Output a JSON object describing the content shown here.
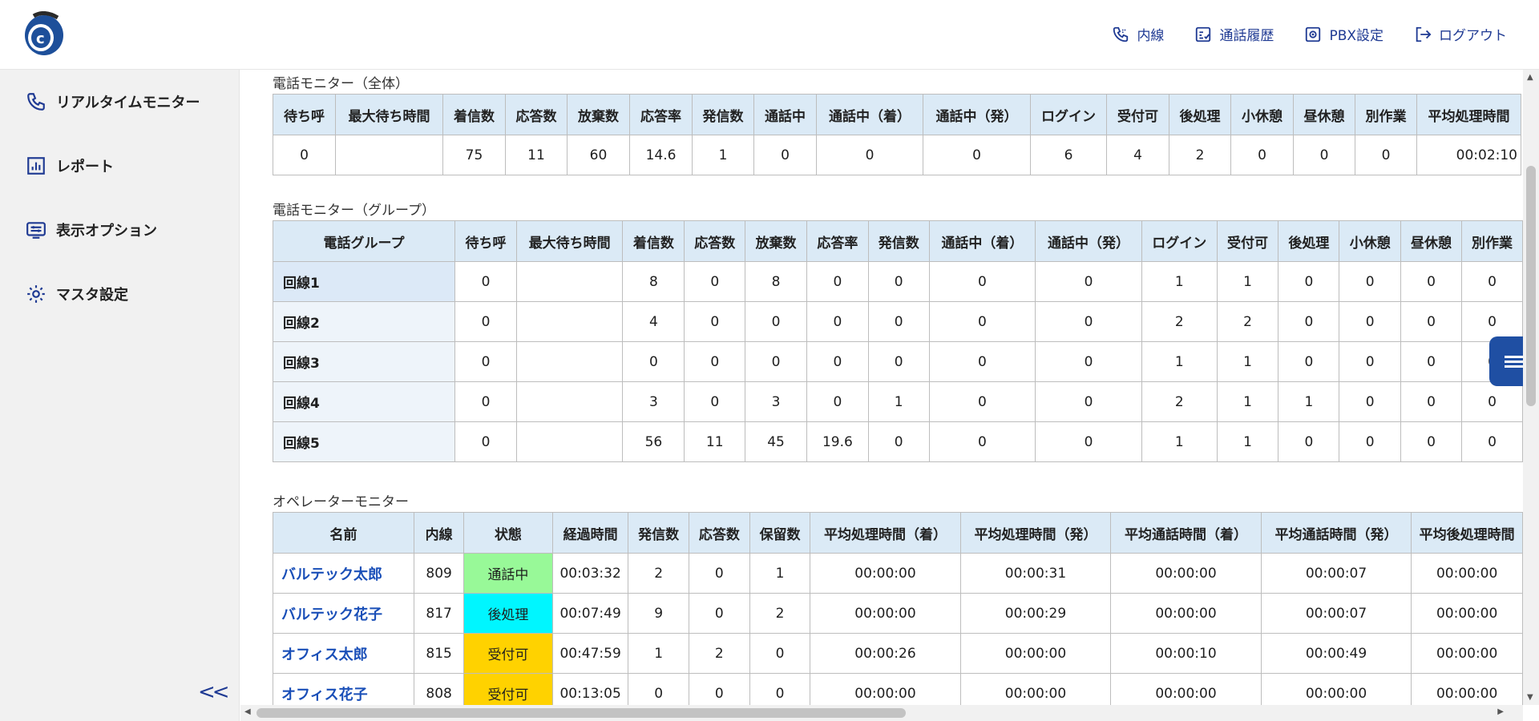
{
  "header": {
    "nav": [
      {
        "label": "内線",
        "icon": "phone-icon"
      },
      {
        "label": "通話履歴",
        "icon": "history-icon"
      },
      {
        "label": "PBX設定",
        "icon": "settings-icon"
      },
      {
        "label": "ログアウト",
        "icon": "logout-icon"
      }
    ]
  },
  "sidebar": {
    "items": [
      {
        "label": "リアルタイムモニター",
        "icon": "phone-icon"
      },
      {
        "label": "レポート",
        "icon": "chart-icon"
      },
      {
        "label": "表示オプション",
        "icon": "display-options-icon"
      },
      {
        "label": "マスタ設定",
        "icon": "gear-icon"
      }
    ],
    "collapse_label": "<<"
  },
  "overall": {
    "title": "電話モニター（全体）",
    "headers": [
      "待ち呼",
      "最大待ち時間",
      "着信数",
      "応答数",
      "放棄数",
      "応答率",
      "発信数",
      "通話中",
      "通話中（着）",
      "通話中（発）",
      "ログイン",
      "受付可",
      "後処理",
      "小休憩",
      "昼休憩",
      "別作業",
      "平均処理時間"
    ],
    "values": [
      "0",
      "",
      "75",
      "11",
      "60",
      "14.6",
      "1",
      "0",
      "0",
      "0",
      "6",
      "4",
      "2",
      "0",
      "0",
      "0",
      "00:02:10"
    ]
  },
  "group": {
    "title": "電話モニター（グループ）",
    "headers": [
      "電話グループ",
      "待ち呼",
      "最大待ち時間",
      "着信数",
      "応答数",
      "放棄数",
      "応答率",
      "発信数",
      "通話中（着）",
      "通話中（発）",
      "ログイン",
      "受付可",
      "後処理",
      "小休憩",
      "昼休憩",
      "別作業"
    ],
    "rows": [
      [
        "回線1",
        "0",
        "",
        "8",
        "0",
        "8",
        "0",
        "0",
        "0",
        "0",
        "1",
        "1",
        "0",
        "0",
        "0",
        "0"
      ],
      [
        "回線2",
        "0",
        "",
        "4",
        "0",
        "0",
        "0",
        "0",
        "0",
        "0",
        "2",
        "2",
        "0",
        "0",
        "0",
        "0"
      ],
      [
        "回線3",
        "0",
        "",
        "0",
        "0",
        "0",
        "0",
        "0",
        "0",
        "0",
        "1",
        "1",
        "0",
        "0",
        "0",
        "0"
      ],
      [
        "回線4",
        "0",
        "",
        "3",
        "0",
        "3",
        "0",
        "1",
        "0",
        "0",
        "2",
        "1",
        "1",
        "0",
        "0",
        "0"
      ],
      [
        "回線5",
        "0",
        "",
        "56",
        "11",
        "45",
        "19.6",
        "0",
        "0",
        "0",
        "1",
        "1",
        "0",
        "0",
        "0",
        "0"
      ]
    ]
  },
  "operator": {
    "title": "オペレーターモニター",
    "headers": [
      "名前",
      "内線",
      "状態",
      "経過時間",
      "発信数",
      "応答数",
      "保留数",
      "平均処理時間（着）",
      "平均処理時間（発）",
      "平均通話時間（着）",
      "平均通話時間（発）",
      "平均後処理時間"
    ],
    "rows": [
      [
        "バルテック太郎",
        "809",
        "通話中",
        "00:03:32",
        "2",
        "0",
        "1",
        "00:00:00",
        "00:00:31",
        "00:00:00",
        "00:00:07",
        "00:00:00"
      ],
      [
        "バルテック花子",
        "817",
        "後処理",
        "00:07:49",
        "9",
        "0",
        "2",
        "00:00:00",
        "00:00:29",
        "00:00:00",
        "00:00:07",
        "00:00:00"
      ],
      [
        "オフィス太郎",
        "815",
        "受付可",
        "00:47:59",
        "1",
        "2",
        "0",
        "00:00:26",
        "00:00:00",
        "00:00:10",
        "00:00:49",
        "00:00:00"
      ],
      [
        "オフィス花子",
        "808",
        "受付可",
        "00:13:05",
        "0",
        "0",
        "0",
        "00:00:00",
        "00:00:00",
        "00:00:00",
        "00:00:00",
        "00:00:00"
      ]
    ],
    "status_colors": {
      "通話中": "#98f998",
      "後処理": "#00f6ff",
      "受付可": "#ffd200"
    }
  }
}
